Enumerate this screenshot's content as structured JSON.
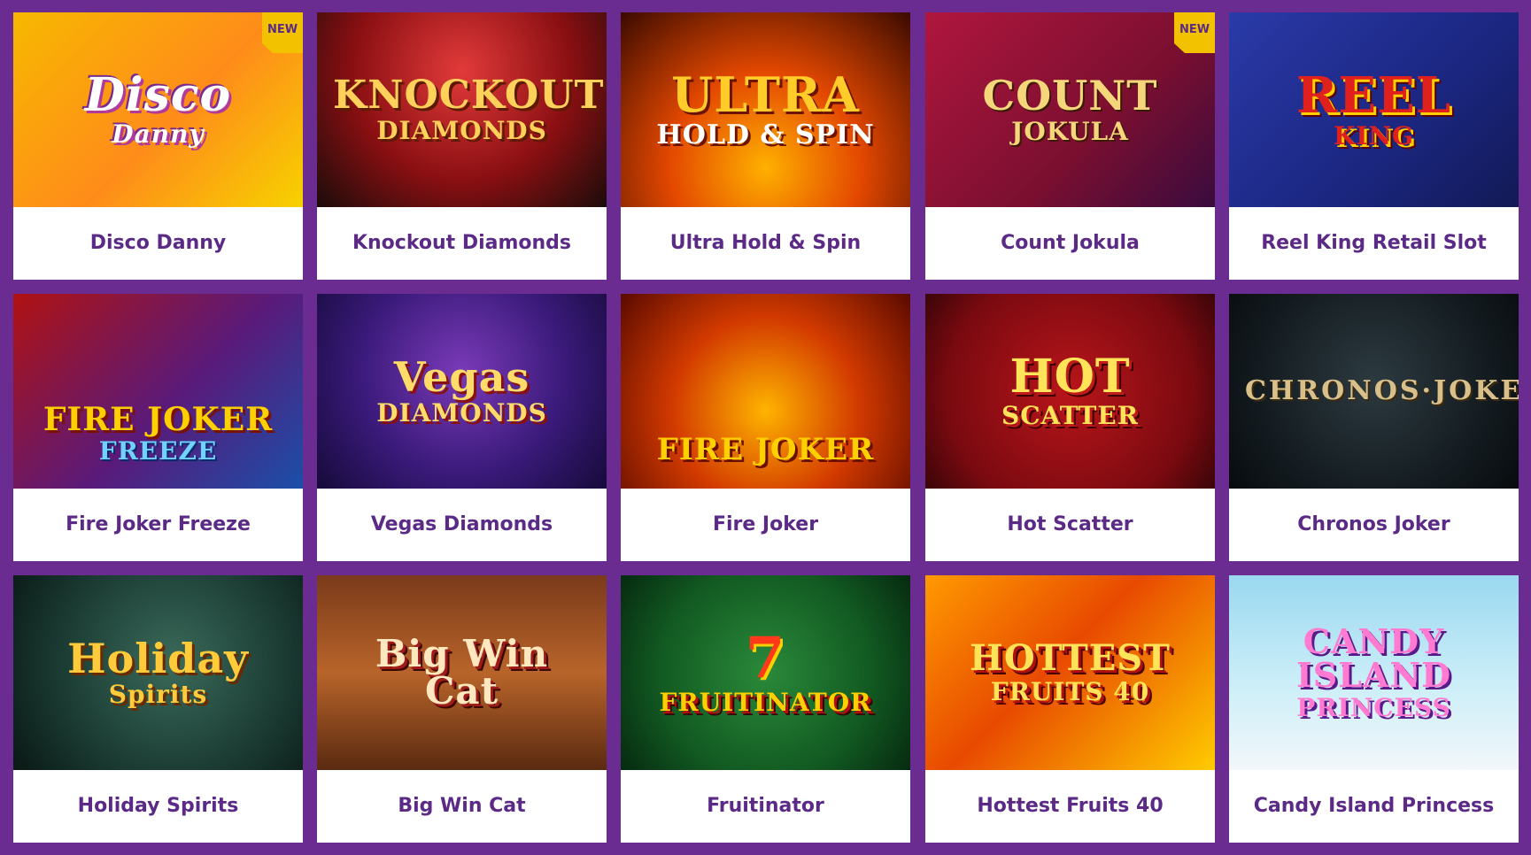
{
  "colors": {
    "background": "#6b2c91",
    "card_background": "#ffffff",
    "caption_text": "#5b2a86",
    "badge_background": "#f2c100"
  },
  "games": [
    {
      "title": "Disco Danny",
      "badge": "NEW",
      "thumb_lines": [
        "Disco",
        "Danny"
      ]
    },
    {
      "title": "Knockout Diamonds",
      "badge": "",
      "thumb_lines": [
        "KNOCKOUT",
        "DIAMONDS"
      ]
    },
    {
      "title": "Ultra Hold & Spin",
      "badge": "",
      "thumb_lines": [
        "ULTRA",
        "HOLD & SPIN"
      ]
    },
    {
      "title": "Count Jokula",
      "badge": "NEW",
      "thumb_lines": [
        "COUNT",
        "JOKULA"
      ]
    },
    {
      "title": "Reel King Retail Slot",
      "badge": "",
      "thumb_lines": [
        "REEL",
        "KING"
      ]
    },
    {
      "title": "Fire Joker Freeze",
      "badge": "",
      "thumb_lines": [
        "FIRE JOKER",
        "FREEZE"
      ]
    },
    {
      "title": "Vegas Diamonds",
      "badge": "",
      "thumb_lines": [
        "Vegas",
        "DIAMONDS"
      ]
    },
    {
      "title": "Fire Joker",
      "badge": "",
      "thumb_lines": [
        "FIRE JOKER",
        ""
      ]
    },
    {
      "title": "Hot Scatter",
      "badge": "",
      "thumb_lines": [
        "HOT",
        "SCATTER"
      ]
    },
    {
      "title": "Chronos Joker",
      "badge": "",
      "thumb_lines": [
        "CHRONOS·JOKER",
        ""
      ]
    },
    {
      "title": "Holiday Spirits",
      "badge": "",
      "thumb_lines": [
        "Holiday",
        "Spirits"
      ]
    },
    {
      "title": "Big Win Cat",
      "badge": "",
      "thumb_lines": [
        "Big Win Cat",
        ""
      ]
    },
    {
      "title": "Fruitinator",
      "badge": "",
      "thumb_lines": [
        "7",
        "FRUITINATOR"
      ]
    },
    {
      "title": "Hottest Fruits 40",
      "badge": "",
      "thumb_lines": [
        "HOTTEST",
        "FRUITS 40"
      ]
    },
    {
      "title": "Candy Island Princess",
      "badge": "",
      "thumb_lines": [
        "CANDY ISLAND",
        "PRINCESS"
      ]
    }
  ]
}
